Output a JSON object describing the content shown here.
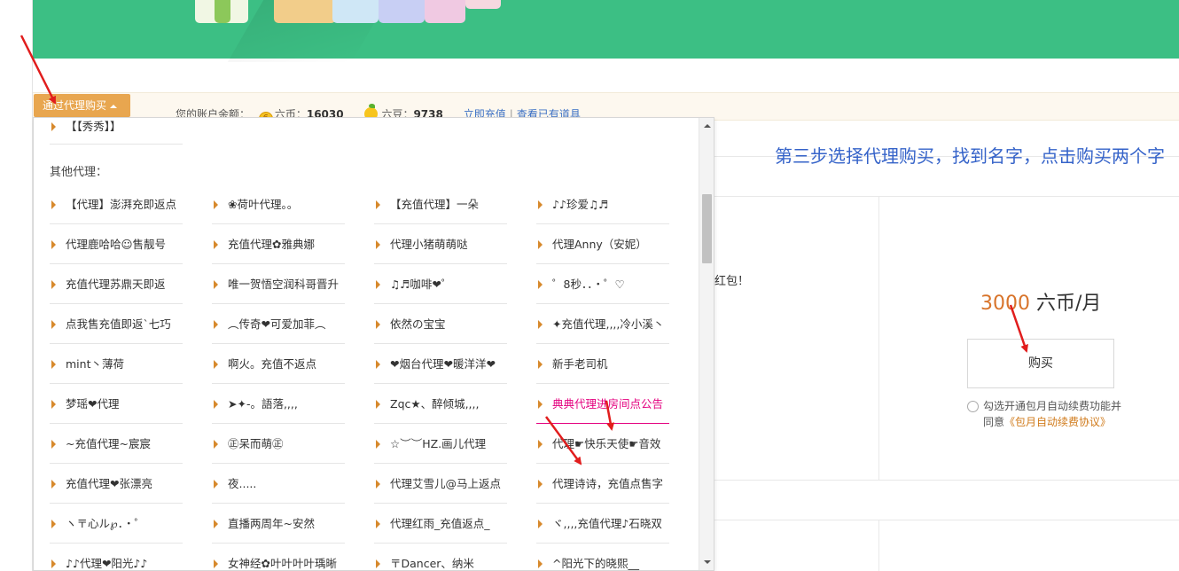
{
  "banner": {
    "bg_color": "#3cbf84",
    "card_colors": [
      "#f1f7e4",
      "#8cc85a",
      "#f2cd8a",
      "#cfe7f6",
      "#c8cff4",
      "#f0c9e2",
      "#f6d8e0"
    ]
  },
  "account": {
    "agent_button_label": "通过代理购买",
    "balance_label": "您的账户余额：",
    "coin_icon_label": "6",
    "liubi_label": "六币：",
    "liubi_value": "16030",
    "liudou_label": "六豆：",
    "liudou_value": "9738",
    "recharge_link": "立即充值",
    "separator": "|",
    "items_link": "查看已有道具"
  },
  "annotation": {
    "text": "第三步选择代理购买，找到名字，点击购买两个字",
    "color": "#3563c9"
  },
  "main": {
    "fragment_text": "红包！"
  },
  "product": {
    "price_number": "3000",
    "price_unit": " 六币/月",
    "buy_button_label": "购买",
    "agree_line1": "勾选开通包月自动续费功能并",
    "agree_prefix": "同意",
    "agree_link": "《包月自动续费协议》"
  },
  "dropdown": {
    "top_item": "【【秀秀】】",
    "section_title": "其他代理：",
    "agents": [
      [
        "【代理】澎湃充即返点",
        "❀荷叶代理。。",
        "【充值代理】一朵",
        "♪♪珍爱♫♬"
      ],
      [
        "代理鹿哈哈☺售靓号",
        "充值代理✿雅典娜",
        "代理小猪萌萌哒",
        "代理Anny（安妮）"
      ],
      [
        "充值代理苏鼎天即返",
        "唯一贺悟空润科哥晋升",
        "♫♬咖啡❤゜",
        "゜8秒．．・゜♡"
      ],
      [
        "点我售充值即返`七巧",
        "︵传奇❤可爱加菲︵",
        "依然の宝宝",
        "✦充值代理,,,,冷小溪丶"
      ],
      [
        "mint丶薄荷",
        "啊火。充值不返点",
        "❤烟台代理❤暖洋洋❤",
        "新手老司机"
      ],
      [
        "梦瑶❤代理",
        "➤✦-。語落,,,,",
        "Zqc★、醉倾城,,,,",
        "典典代理进房间点公告"
      ],
      [
        "~充值代理~宸宸",
        "㊣呆而萌㊣",
        "☆︶︶HZ.画儿代理",
        "代理☛快乐天使☛音效"
      ],
      [
        "充值代理❤张漂亮",
        "夜.....",
        "代理艾雪儿@马上返点",
        "代理诗诗，充值点售字"
      ],
      [
        "ヽ〒心ル℘．・゜",
        "直播两周年~安然",
        "代理红雨_充值返点_",
        "ヾ,,,,充值代理♪石晓双"
      ],
      [
        "♪♪代理❤阳光♪♪",
        "女神经✿叶叶叶叶瑀晰",
        "〒Dancer、纳米",
        "^阳光下的晓熙__"
      ]
    ],
    "highlight_color": "#e4007f"
  }
}
